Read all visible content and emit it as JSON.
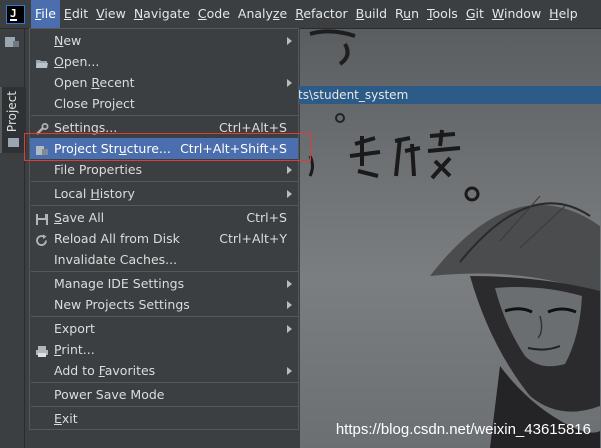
{
  "menubar": {
    "items": [
      {
        "label": "File",
        "u": "F",
        "rest": "ile"
      },
      {
        "label": "Edit",
        "u": "E",
        "rest": "dit"
      },
      {
        "label": "View",
        "u": "V",
        "rest": "iew"
      },
      {
        "label": "Navigate",
        "u": "N",
        "rest": "avigate"
      },
      {
        "label": "Code",
        "u": "C",
        "rest": "ode"
      },
      {
        "label": "Analyze",
        "pre": "Analy",
        "u": "z",
        "rest": "e"
      },
      {
        "label": "Refactor",
        "u": "R",
        "rest": "efactor"
      },
      {
        "label": "Build",
        "u": "B",
        "rest": "uild"
      },
      {
        "label": "Run",
        "pre": "R",
        "u": "u",
        "rest": "n"
      },
      {
        "label": "Tools",
        "u": "T",
        "rest": "ools"
      },
      {
        "label": "Git",
        "u": "G",
        "rest": "it"
      },
      {
        "label": "Window",
        "u": "W",
        "rest": "indow"
      },
      {
        "label": "Help",
        "u": "H",
        "rest": "elp"
      }
    ]
  },
  "sidebar": {
    "project_tab": "Project"
  },
  "editor": {
    "path_fragment": "ts\\student_system"
  },
  "file_menu": {
    "items": [
      {
        "label": "New",
        "u": "N",
        "rest": "ew",
        "submenu": true
      },
      {
        "label": "Open...",
        "u": "O",
        "rest": "pen...",
        "icon": "folder-open-icon"
      },
      {
        "label": "Open Recent",
        "pre": "Open ",
        "u": "R",
        "rest": "ecent",
        "submenu": true
      },
      {
        "label": "Close Project",
        "pre": "Close Pro",
        "u": "j",
        "rest": "ect"
      },
      {
        "label": "Settings...",
        "pre": "Se",
        "u": "t",
        "rest": "tings...",
        "shortcut": "Ctrl+Alt+S",
        "icon": "wrench-icon"
      },
      {
        "label": "Project Structure...",
        "pre": "Project Str",
        "u": "u",
        "rest": "cture...",
        "shortcut": "Ctrl+Alt+Shift+S",
        "icon": "project-structure-icon",
        "selected": true
      },
      {
        "label": "File Properties",
        "submenu": true
      },
      {
        "label": "Local History",
        "pre": "Local ",
        "u": "H",
        "rest": "istory",
        "submenu": true
      },
      {
        "label": "Save All",
        "u": "S",
        "rest": "ave All",
        "shortcut": "Ctrl+S",
        "icon": "save-icon"
      },
      {
        "label": "Reload All from Disk",
        "shortcut": "Ctrl+Alt+Y",
        "icon": "reload-icon"
      },
      {
        "label": "Invalidate Caches..."
      },
      {
        "label": "Manage IDE Settings",
        "submenu": true
      },
      {
        "label": "New Projects Settings",
        "submenu": true
      },
      {
        "label": "Export",
        "submenu": true
      },
      {
        "label": "Print...",
        "u": "P",
        "rest": "rint...",
        "icon": "print-icon"
      },
      {
        "label": "Add to Favorites",
        "pre": "Add to ",
        "u": "F",
        "rest": "avorites",
        "submenu": true
      },
      {
        "label": "Power Save Mode"
      },
      {
        "label": "Exit",
        "u": "E",
        "rest": "xit"
      }
    ]
  },
  "watermark": "https://blog.csdn.net/weixin_43615816",
  "colors": {
    "accent": "#4b6eaf",
    "highlight_box": "#e03b3b",
    "menu_bg": "#3c3f41"
  }
}
